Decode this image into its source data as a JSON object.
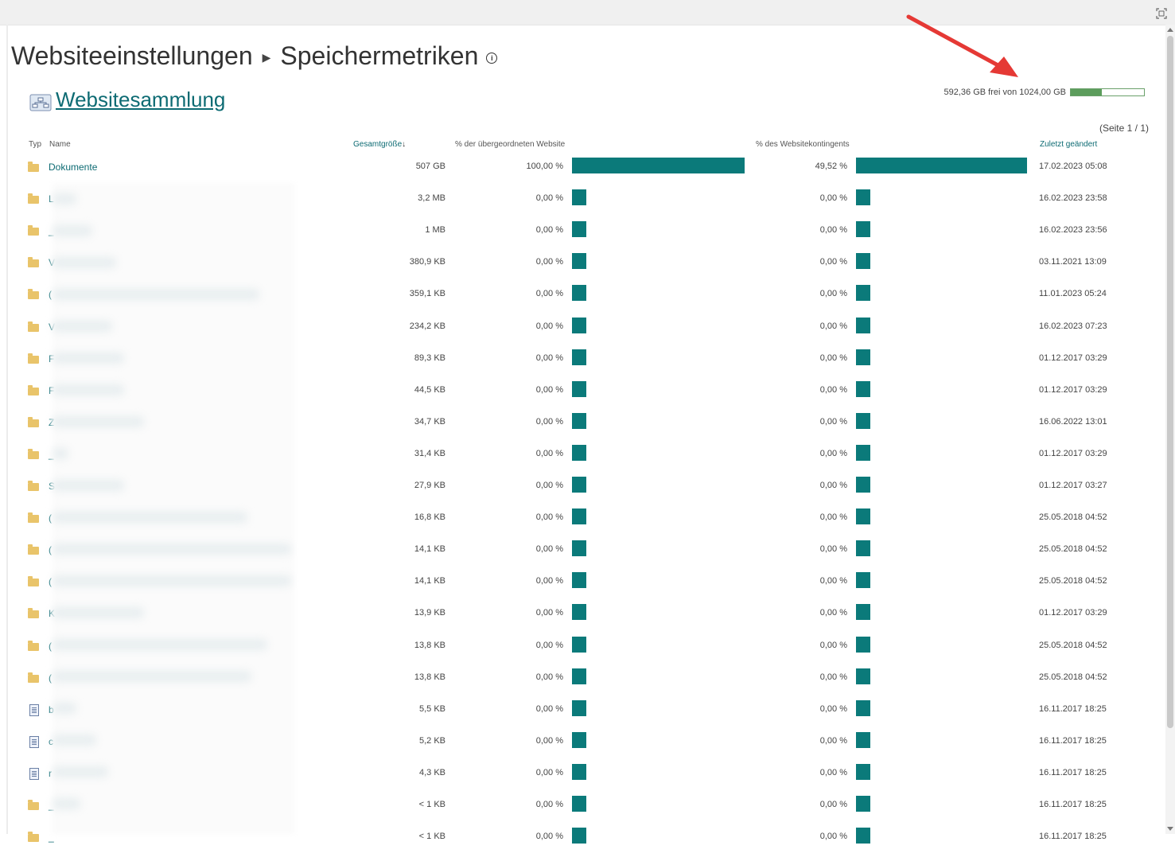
{
  "breadcrumb": {
    "parent": "Websiteeinstellungen",
    "current": "Speichermetriken"
  },
  "collection": {
    "label": "Websitesammlung"
  },
  "quota": {
    "text": "592,36 GB frei von 1024,00 GB",
    "used_fraction": 0.42
  },
  "pagination": {
    "text": "(Seite 1 / 1)"
  },
  "columns": {
    "type": "Typ",
    "name": "Name",
    "total_size": "Gesamtgröße",
    "pct_parent": "% der übergeordneten Website",
    "pct_quota": "% des Websitekontingents",
    "modified": "Zuletzt geändert"
  },
  "rows": [
    {
      "icon": "folder-icon",
      "name": "Dokumente",
      "size": "507 GB",
      "pct_parent": "100,00 %",
      "pct_quota": "49,52 %",
      "modified": "17.02.2023 05:08",
      "parent_fraction": 1.0,
      "quota_fraction": 0.4952
    },
    {
      "icon": "folder-icon",
      "name": "L",
      "size": "3,2 MB",
      "pct_parent": "0,00 %",
      "pct_quota": "0,00 %",
      "modified": "16.02.2023 23:58",
      "parent_fraction": 0,
      "quota_fraction": 0
    },
    {
      "icon": "folder-icon",
      "name": "_",
      "size": "1 MB",
      "pct_parent": "0,00 %",
      "pct_quota": "0,00 %",
      "modified": "16.02.2023 23:56",
      "parent_fraction": 0,
      "quota_fraction": 0
    },
    {
      "icon": "folder-icon",
      "name": "V",
      "size": "380,9 KB",
      "pct_parent": "0,00 %",
      "pct_quota": "0,00 %",
      "modified": "03.11.2021 13:09",
      "parent_fraction": 0,
      "quota_fraction": 0
    },
    {
      "icon": "folder-icon",
      "name": "(",
      "size": "359,1 KB",
      "pct_parent": "0,00 %",
      "pct_quota": "0,00 %",
      "modified": "11.01.2023 05:24",
      "parent_fraction": 0,
      "quota_fraction": 0
    },
    {
      "icon": "folder-icon",
      "name": "V",
      "size": "234,2 KB",
      "pct_parent": "0,00 %",
      "pct_quota": "0,00 %",
      "modified": "16.02.2023 07:23",
      "parent_fraction": 0,
      "quota_fraction": 0
    },
    {
      "icon": "folder-icon",
      "name": "F",
      "size": "89,3 KB",
      "pct_parent": "0,00 %",
      "pct_quota": "0,00 %",
      "modified": "01.12.2017 03:29",
      "parent_fraction": 0,
      "quota_fraction": 0
    },
    {
      "icon": "folder-icon",
      "name": "F",
      "size": "44,5 KB",
      "pct_parent": "0,00 %",
      "pct_quota": "0,00 %",
      "modified": "01.12.2017 03:29",
      "parent_fraction": 0,
      "quota_fraction": 0
    },
    {
      "icon": "folder-icon",
      "name": "Z",
      "size": "34,7 KB",
      "pct_parent": "0,00 %",
      "pct_quota": "0,00 %",
      "modified": "16.06.2022 13:01",
      "parent_fraction": 0,
      "quota_fraction": 0
    },
    {
      "icon": "folder-icon",
      "name": "_",
      "size": "31,4 KB",
      "pct_parent": "0,00 %",
      "pct_quota": "0,00 %",
      "modified": "01.12.2017 03:29",
      "parent_fraction": 0,
      "quota_fraction": 0
    },
    {
      "icon": "folder-icon",
      "name": "S",
      "size": "27,9 KB",
      "pct_parent": "0,00 %",
      "pct_quota": "0,00 %",
      "modified": "01.12.2017 03:27",
      "parent_fraction": 0,
      "quota_fraction": 0
    },
    {
      "icon": "folder-icon",
      "name": "(",
      "size": "16,8 KB",
      "pct_parent": "0,00 %",
      "pct_quota": "0,00 %",
      "modified": "25.05.2018 04:52",
      "parent_fraction": 0,
      "quota_fraction": 0
    },
    {
      "icon": "folder-icon",
      "name": "(",
      "size": "14,1 KB",
      "pct_parent": "0,00 %",
      "pct_quota": "0,00 %",
      "modified": "25.05.2018 04:52",
      "parent_fraction": 0,
      "quota_fraction": 0
    },
    {
      "icon": "folder-icon",
      "name": "(",
      "size": "14,1 KB",
      "pct_parent": "0,00 %",
      "pct_quota": "0,00 %",
      "modified": "25.05.2018 04:52",
      "parent_fraction": 0,
      "quota_fraction": 0
    },
    {
      "icon": "folder-icon",
      "name": "K",
      "size": "13,9 KB",
      "pct_parent": "0,00 %",
      "pct_quota": "0,00 %",
      "modified": "01.12.2017 03:29",
      "parent_fraction": 0,
      "quota_fraction": 0
    },
    {
      "icon": "folder-icon",
      "name": "(",
      "size": "13,8 KB",
      "pct_parent": "0,00 %",
      "pct_quota": "0,00 %",
      "modified": "25.05.2018 04:52",
      "parent_fraction": 0,
      "quota_fraction": 0
    },
    {
      "icon": "folder-icon",
      "name": "(",
      "size": "13,8 KB",
      "pct_parent": "0,00 %",
      "pct_quota": "0,00 %",
      "modified": "25.05.2018 04:52",
      "parent_fraction": 0,
      "quota_fraction": 0
    },
    {
      "icon": "file-icon",
      "name": "b",
      "size": "5,5 KB",
      "pct_parent": "0,00 %",
      "pct_quota": "0,00 %",
      "modified": "16.11.2017 18:25",
      "parent_fraction": 0,
      "quota_fraction": 0
    },
    {
      "icon": "file-icon",
      "name": "c",
      "size": "5,2 KB",
      "pct_parent": "0,00 %",
      "pct_quota": "0,00 %",
      "modified": "16.11.2017 18:25",
      "parent_fraction": 0,
      "quota_fraction": 0
    },
    {
      "icon": "file-icon",
      "name": "r",
      "size": "4,3 KB",
      "pct_parent": "0,00 %",
      "pct_quota": "0,00 %",
      "modified": "16.11.2017 18:25",
      "parent_fraction": 0,
      "quota_fraction": 0
    },
    {
      "icon": "folder-icon",
      "name": "_",
      "size": "< 1 KB",
      "pct_parent": "0,00 %",
      "pct_quota": "0,00 %",
      "modified": "16.11.2017 18:25",
      "parent_fraction": 0,
      "quota_fraction": 0
    },
    {
      "icon": "folder-icon",
      "name": "_",
      "size": "< 1 KB",
      "pct_parent": "0,00 %",
      "pct_quota": "0,00 %",
      "modified": "16.11.2017 18:25",
      "parent_fraction": 0,
      "quota_fraction": 0
    }
  ],
  "colors": {
    "accent": "#0d6b73",
    "bar": "#0b7a7a",
    "quota_fill": "#5c9d5c",
    "arrow": "#e53935"
  }
}
